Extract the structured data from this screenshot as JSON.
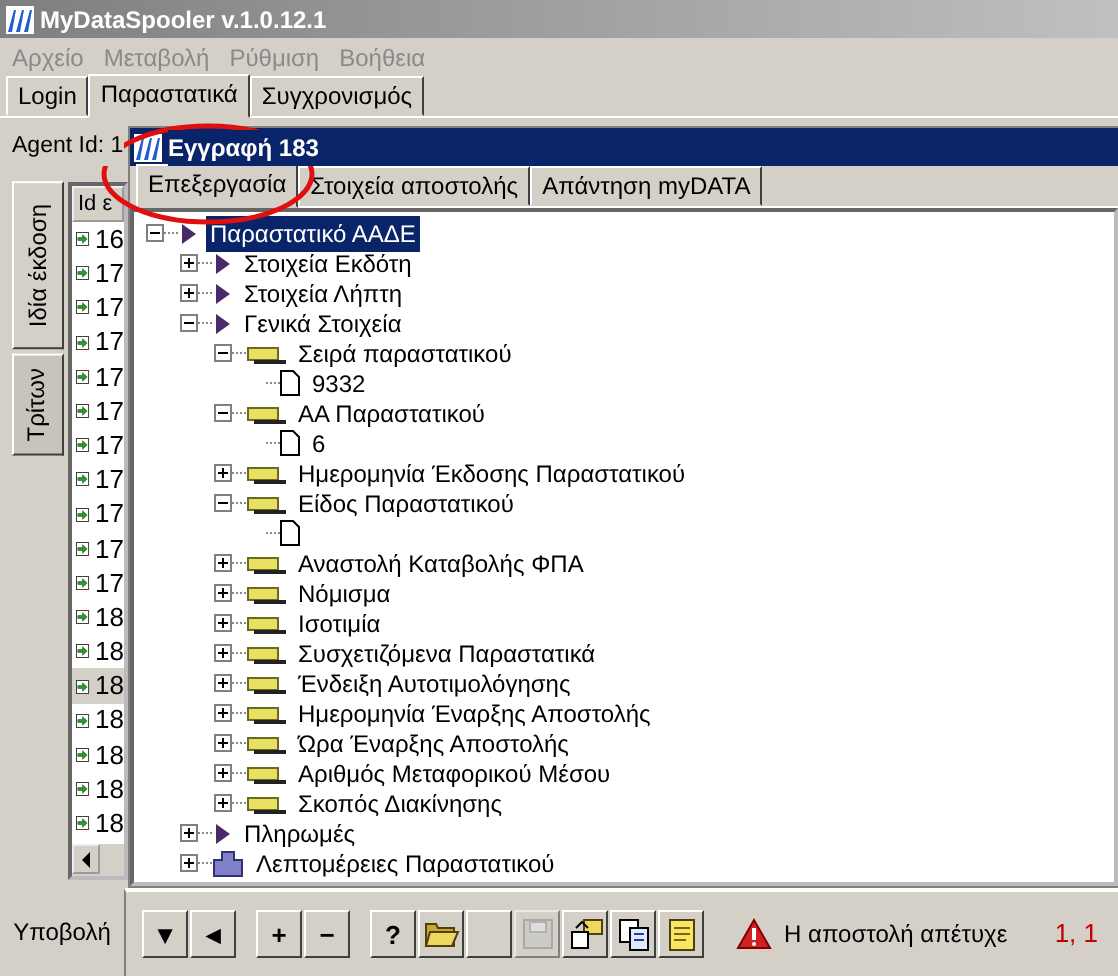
{
  "window": {
    "title": "MyDataSpooler v.1.0.12.1"
  },
  "menu": [
    {
      "label": "Αρχείο",
      "disabled": true
    },
    {
      "label": "Μεταβολή",
      "disabled": true
    },
    {
      "label": "Ρύθμιση",
      "disabled": true
    },
    {
      "label": "Βοήθεια",
      "disabled": true
    }
  ],
  "tabs": [
    {
      "label": "Login",
      "selected": false
    },
    {
      "label": "Παραστατικά",
      "selected": true
    },
    {
      "label": "Συγχρονισμός",
      "selected": false
    }
  ],
  "agent_label": "Agent Id: 1",
  "side_tabs": [
    {
      "label": "Ιδία έκδοση",
      "selected": true
    },
    {
      "label": "Τρίτων",
      "selected": false
    }
  ],
  "list": {
    "column": "Id ε",
    "rows": [
      {
        "id": "16",
        "selected": false
      },
      {
        "id": "17",
        "selected": false
      },
      {
        "id": "17",
        "selected": false
      },
      {
        "id": "17",
        "selected": false
      },
      {
        "id": "17",
        "selected": false
      },
      {
        "id": "17",
        "selected": false
      },
      {
        "id": "17",
        "selected": false
      },
      {
        "id": "17",
        "selected": false
      },
      {
        "id": "17",
        "selected": false
      },
      {
        "id": "17",
        "selected": false
      },
      {
        "id": "17",
        "selected": false
      },
      {
        "id": "18",
        "selected": false
      },
      {
        "id": "18",
        "selected": false
      },
      {
        "id": "18",
        "selected": true
      },
      {
        "id": "18",
        "selected": false
      },
      {
        "id": "18",
        "selected": false
      },
      {
        "id": "18",
        "selected": false
      },
      {
        "id": "18",
        "selected": false
      }
    ]
  },
  "record": {
    "title": "Εγγραφή 183",
    "tabs": [
      {
        "label": "Επεξεργασία",
        "selected": true
      },
      {
        "label": "Στοιχεία αποστολής",
        "selected": false
      },
      {
        "label": "Απάντηση myDATA",
        "selected": false
      }
    ],
    "tree": [
      {
        "kind": "doc",
        "label": "Παραστατικό ΑΑΔΕ",
        "expanded": true,
        "selected": true,
        "children": [
          {
            "kind": "doc",
            "label": "Στοιχεία Εκδότη",
            "expanded": false,
            "selected": false
          },
          {
            "kind": "doc",
            "label": "Στοιχεία Λήπτη",
            "expanded": false,
            "selected": false
          },
          {
            "kind": "doc",
            "label": "Γενικά Στοιχεία",
            "expanded": true,
            "selected": false,
            "children": [
              {
                "kind": "field",
                "label": "Σειρά παραστατικού",
                "expanded": true,
                "selected": false,
                "children": [
                  {
                    "kind": "value",
                    "label": "9332",
                    "selected": false
                  }
                ]
              },
              {
                "kind": "field",
                "label": "ΑΑ Παραστατικού",
                "expanded": true,
                "selected": false,
                "children": [
                  {
                    "kind": "value",
                    "label": "6",
                    "selected": false
                  }
                ]
              },
              {
                "kind": "field",
                "label": "Ημερομηνία Έκδοσης Παραστατικού",
                "expanded": false,
                "selected": false
              },
              {
                "kind": "field",
                "label": "Είδος Παραστατικού",
                "expanded": true,
                "selected": false,
                "children": [
                  {
                    "kind": "value",
                    "selected": false
                  }
                ]
              },
              {
                "kind": "field",
                "label": "Αναστολή Καταβολής ΦΠΑ",
                "expanded": false,
                "selected": false
              },
              {
                "kind": "field",
                "label": "Νόμισμα",
                "expanded": false,
                "selected": false
              },
              {
                "kind": "field",
                "label": "Ισοτιμία",
                "expanded": false,
                "selected": false
              },
              {
                "kind": "field",
                "label": "Συσχετιζόμενα Παραστατικά",
                "expanded": false,
                "selected": false
              },
              {
                "kind": "field",
                "label": "Ένδειξη Αυτοτιμολόγησης",
                "expanded": false,
                "selected": false
              },
              {
                "kind": "field",
                "label": "Ημερομηνία Έναρξης Αποστολής",
                "expanded": false,
                "selected": false
              },
              {
                "kind": "field",
                "label": "Ώρα Έναρξης Αποστολής",
                "expanded": false,
                "selected": false
              },
              {
                "kind": "field",
                "label": "Αριθμός Μεταφορικού Μέσου",
                "expanded": false,
                "selected": false
              },
              {
                "kind": "field",
                "label": "Σκοπός Διακίνησης",
                "expanded": false,
                "selected": false
              }
            ]
          },
          {
            "kind": "doc",
            "label": "Πληρωμές",
            "expanded": false,
            "selected": false
          },
          {
            "kind": "group",
            "label": "Λεπτομέρειες Παραστατικού",
            "expanded": false,
            "selected": false
          }
        ]
      }
    ]
  },
  "submit_label": "Υποβολή",
  "toolbar": [
    [
      {
        "kind": "char",
        "label": "▼",
        "disabled": false
      },
      {
        "kind": "char",
        "label": "◄",
        "disabled": false
      }
    ],
    [
      {
        "kind": "char",
        "label": "+",
        "disabled": false
      },
      {
        "kind": "char",
        "label": "−",
        "disabled": false
      }
    ],
    [
      {
        "kind": "char",
        "label": "?",
        "disabled": false
      },
      {
        "kind": "open",
        "disabled": false
      },
      {
        "kind": "blank",
        "disabled": false
      },
      {
        "kind": "save",
        "disabled": true
      },
      {
        "kind": "export",
        "disabled": false
      },
      {
        "kind": "copy",
        "disabled": false
      },
      {
        "kind": "note",
        "disabled": false
      }
    ]
  ],
  "status": {
    "message": "Η αποστολή απέτυχε",
    "position": "1, 1"
  }
}
